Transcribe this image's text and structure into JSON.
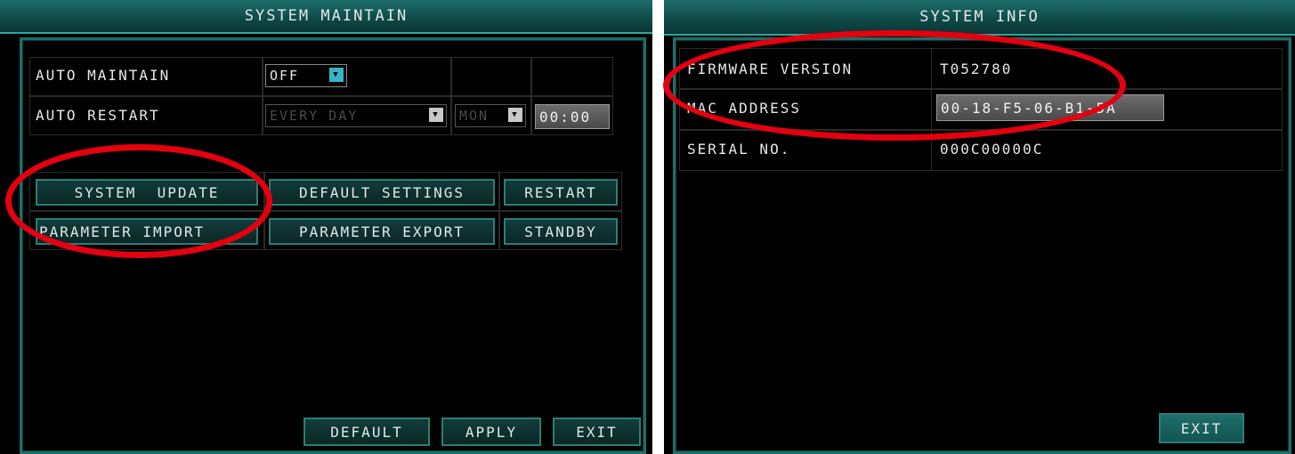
{
  "maintain": {
    "title": "SYSTEM MAINTAIN",
    "auto_maintain_label": "AUTO MAINTAIN",
    "auto_maintain_value": "OFF",
    "auto_restart_label": "AUTO RESTART",
    "auto_restart_period": "EVERY DAY",
    "auto_restart_day": "MON",
    "auto_restart_time": "00:00",
    "buttons": {
      "system_update": "SYSTEM  UPDATE",
      "default_settings": "DEFAULT SETTINGS",
      "restart": "RESTART",
      "parameter_import": "PARAMETER IMPORT",
      "parameter_export": "PARAMETER EXPORT",
      "standby": "STANDBY"
    },
    "footer": {
      "default": "DEFAULT",
      "apply": "APPLY",
      "exit": "EXIT"
    }
  },
  "info": {
    "title": "SYSTEM INFO",
    "rows": [
      {
        "label": "FIRMWARE VERSION",
        "value": "T052780"
      },
      {
        "label": "MAC ADDRESS",
        "value": "00-18-F5-06-B1-5A"
      },
      {
        "label": "SERIAL NO.",
        "value": "000C00000C"
      }
    ],
    "exit": "EXIT"
  },
  "colors": {
    "frame": "#1b6f6a",
    "button_border": "#2c7d78",
    "select_arrow": "#34b6c8",
    "highlight_ellipse": "#e3000f"
  }
}
